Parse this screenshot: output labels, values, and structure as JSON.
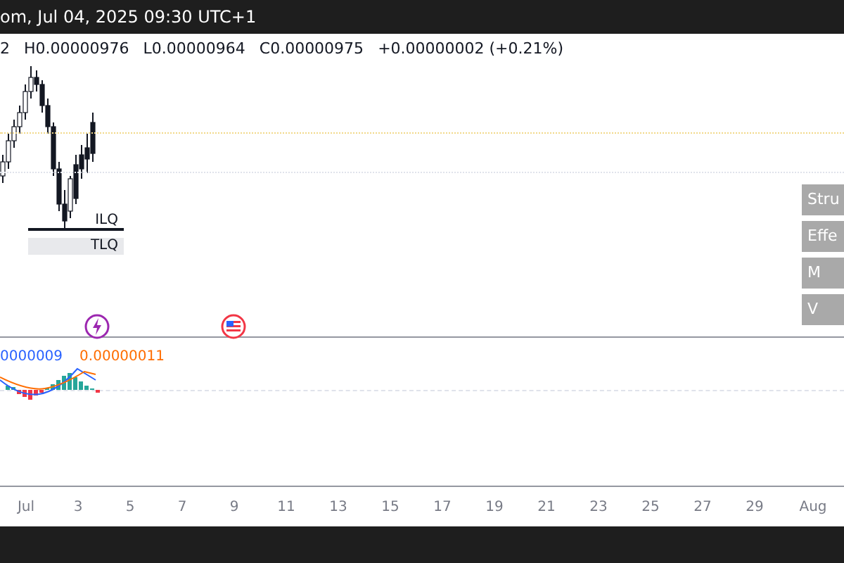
{
  "header": {
    "title": "om, Jul 04, 2025 09:30 UTC+1"
  },
  "ohlc": {
    "open": "2",
    "high": "H0.00000976",
    "low": "L0.00000964",
    "close": "C0.00000975",
    "change": "+0.00000002 (+0.21%)"
  },
  "chart": {
    "labels": [
      "ILQ",
      "TLQ"
    ]
  },
  "side_buttons": [
    "Stru",
    "Effe",
    "M",
    "V"
  ],
  "macd": {
    "values": [
      {
        "text": "0000009",
        "color": "#2962ff"
      },
      {
        "text": "0.00000011",
        "color": "#ff6d00"
      }
    ]
  },
  "time_axis": [
    "Jul",
    "3",
    "5",
    "7",
    "9",
    "11",
    "13",
    "15",
    "17",
    "19",
    "21",
    "23",
    "25",
    "27",
    "29",
    "Aug"
  ]
}
